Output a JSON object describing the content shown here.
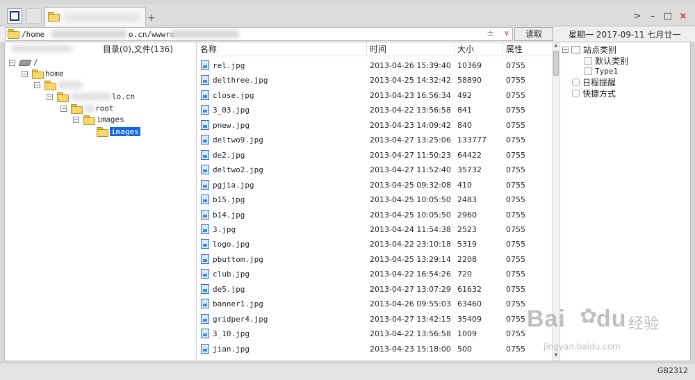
{
  "tabs": {
    "new_tab_symbol": "+"
  },
  "window_controls": {
    "nav": ">",
    "minimize": "–",
    "maximize": "□",
    "close": "×"
  },
  "address": {
    "path_prefix": "/home",
    "path_middle": "o.cn/wwwro",
    "plus_minus": "±",
    "dropdown": "∨",
    "read_button": "读取"
  },
  "date_bar": "星期一 2017-09-11 七月廿一",
  "tree": {
    "summary": "目录(0),文件(136)",
    "nodes": [
      {
        "label": "/",
        "icon": "drive-icon"
      },
      {
        "label": "home"
      },
      {
        "label": ""
      },
      {
        "label": "lo.cn"
      },
      {
        "label": "root"
      },
      {
        "label": "images"
      },
      {
        "label": "images",
        "selected": true
      }
    ]
  },
  "file_list": {
    "columns": {
      "name": "名称",
      "time": "时间",
      "size": "大小",
      "attr": "属性"
    },
    "rows": [
      {
        "name": "rel.jpg",
        "time": "2013-04-26 15:39:40",
        "size": "10369",
        "attr": "0755"
      },
      {
        "name": "delthree.jpg",
        "time": "2013-04-25 14:32:42",
        "size": "58890",
        "attr": "0755"
      },
      {
        "name": "close.jpg",
        "time": "2013-04-23 16:56:34",
        "size": "492",
        "attr": "0755"
      },
      {
        "name": "3_03.jpg",
        "time": "2013-04-22 13:56:58",
        "size": "841",
        "attr": "0755"
      },
      {
        "name": "pnew.jpg",
        "time": "2013-04-23 14:09:42",
        "size": "840",
        "attr": "0755"
      },
      {
        "name": "deltwo9.jpg",
        "time": "2013-04-27 13:25:06",
        "size": "133777",
        "attr": "0755"
      },
      {
        "name": "de2.jpg",
        "time": "2013-04-27 11:50:23",
        "size": "64422",
        "attr": "0755"
      },
      {
        "name": "deltwo2.jpg",
        "time": "2013-04-27 11:52:40",
        "size": "35732",
        "attr": "0755"
      },
      {
        "name": "pgjia.jpg",
        "time": "2013-04-25 09:32:08",
        "size": "410",
        "attr": "0755"
      },
      {
        "name": "b15.jpg",
        "time": "2013-04-25 10:05:50",
        "size": "2483",
        "attr": "0755"
      },
      {
        "name": "b14.jpg",
        "time": "2013-04-25 10:05:50",
        "size": "2960",
        "attr": "0755"
      },
      {
        "name": "3.jpg",
        "time": "2013-04-24 11:54:38",
        "size": "2523",
        "attr": "0755"
      },
      {
        "name": "logo.jpg",
        "time": "2013-04-22 23:10:18",
        "size": "5319",
        "attr": "0755"
      },
      {
        "name": "pbuttom.jpg",
        "time": "2013-04-25 13:29:14",
        "size": "2208",
        "attr": "0755"
      },
      {
        "name": "club.jpg",
        "time": "2013-04-22 16:54:26",
        "size": "720",
        "attr": "0755"
      },
      {
        "name": "de5.jpg",
        "time": "2013-04-27 13:07:29",
        "size": "61632",
        "attr": "0755"
      },
      {
        "name": "banner1.jpg",
        "time": "2013-04-26 09:55:03",
        "size": "63460",
        "attr": "0755"
      },
      {
        "name": "gridper4.jpg",
        "time": "2013-04-27 13:42:15",
        "size": "35409",
        "attr": "0755"
      },
      {
        "name": "3_10.jpg",
        "time": "2013-04-22 13:56:58",
        "size": "1009",
        "attr": "0755"
      },
      {
        "name": "jian.jpg",
        "time": "2013-04-23 15:18:00",
        "size": "500",
        "attr": "0755"
      }
    ]
  },
  "side_panel": {
    "site_category": "站点类别",
    "default_category": "默认类别",
    "type1": "Type1",
    "schedule": "日程提醒",
    "shortcuts": "快捷方式"
  },
  "watermark": {
    "brand": "Bai",
    "brand2": "du",
    "cn": "经验",
    "url": "jingyan.baidu.com"
  },
  "footer_code": "GB2312",
  "colors": {
    "selection": "#1668d6",
    "close": "#d82020"
  }
}
